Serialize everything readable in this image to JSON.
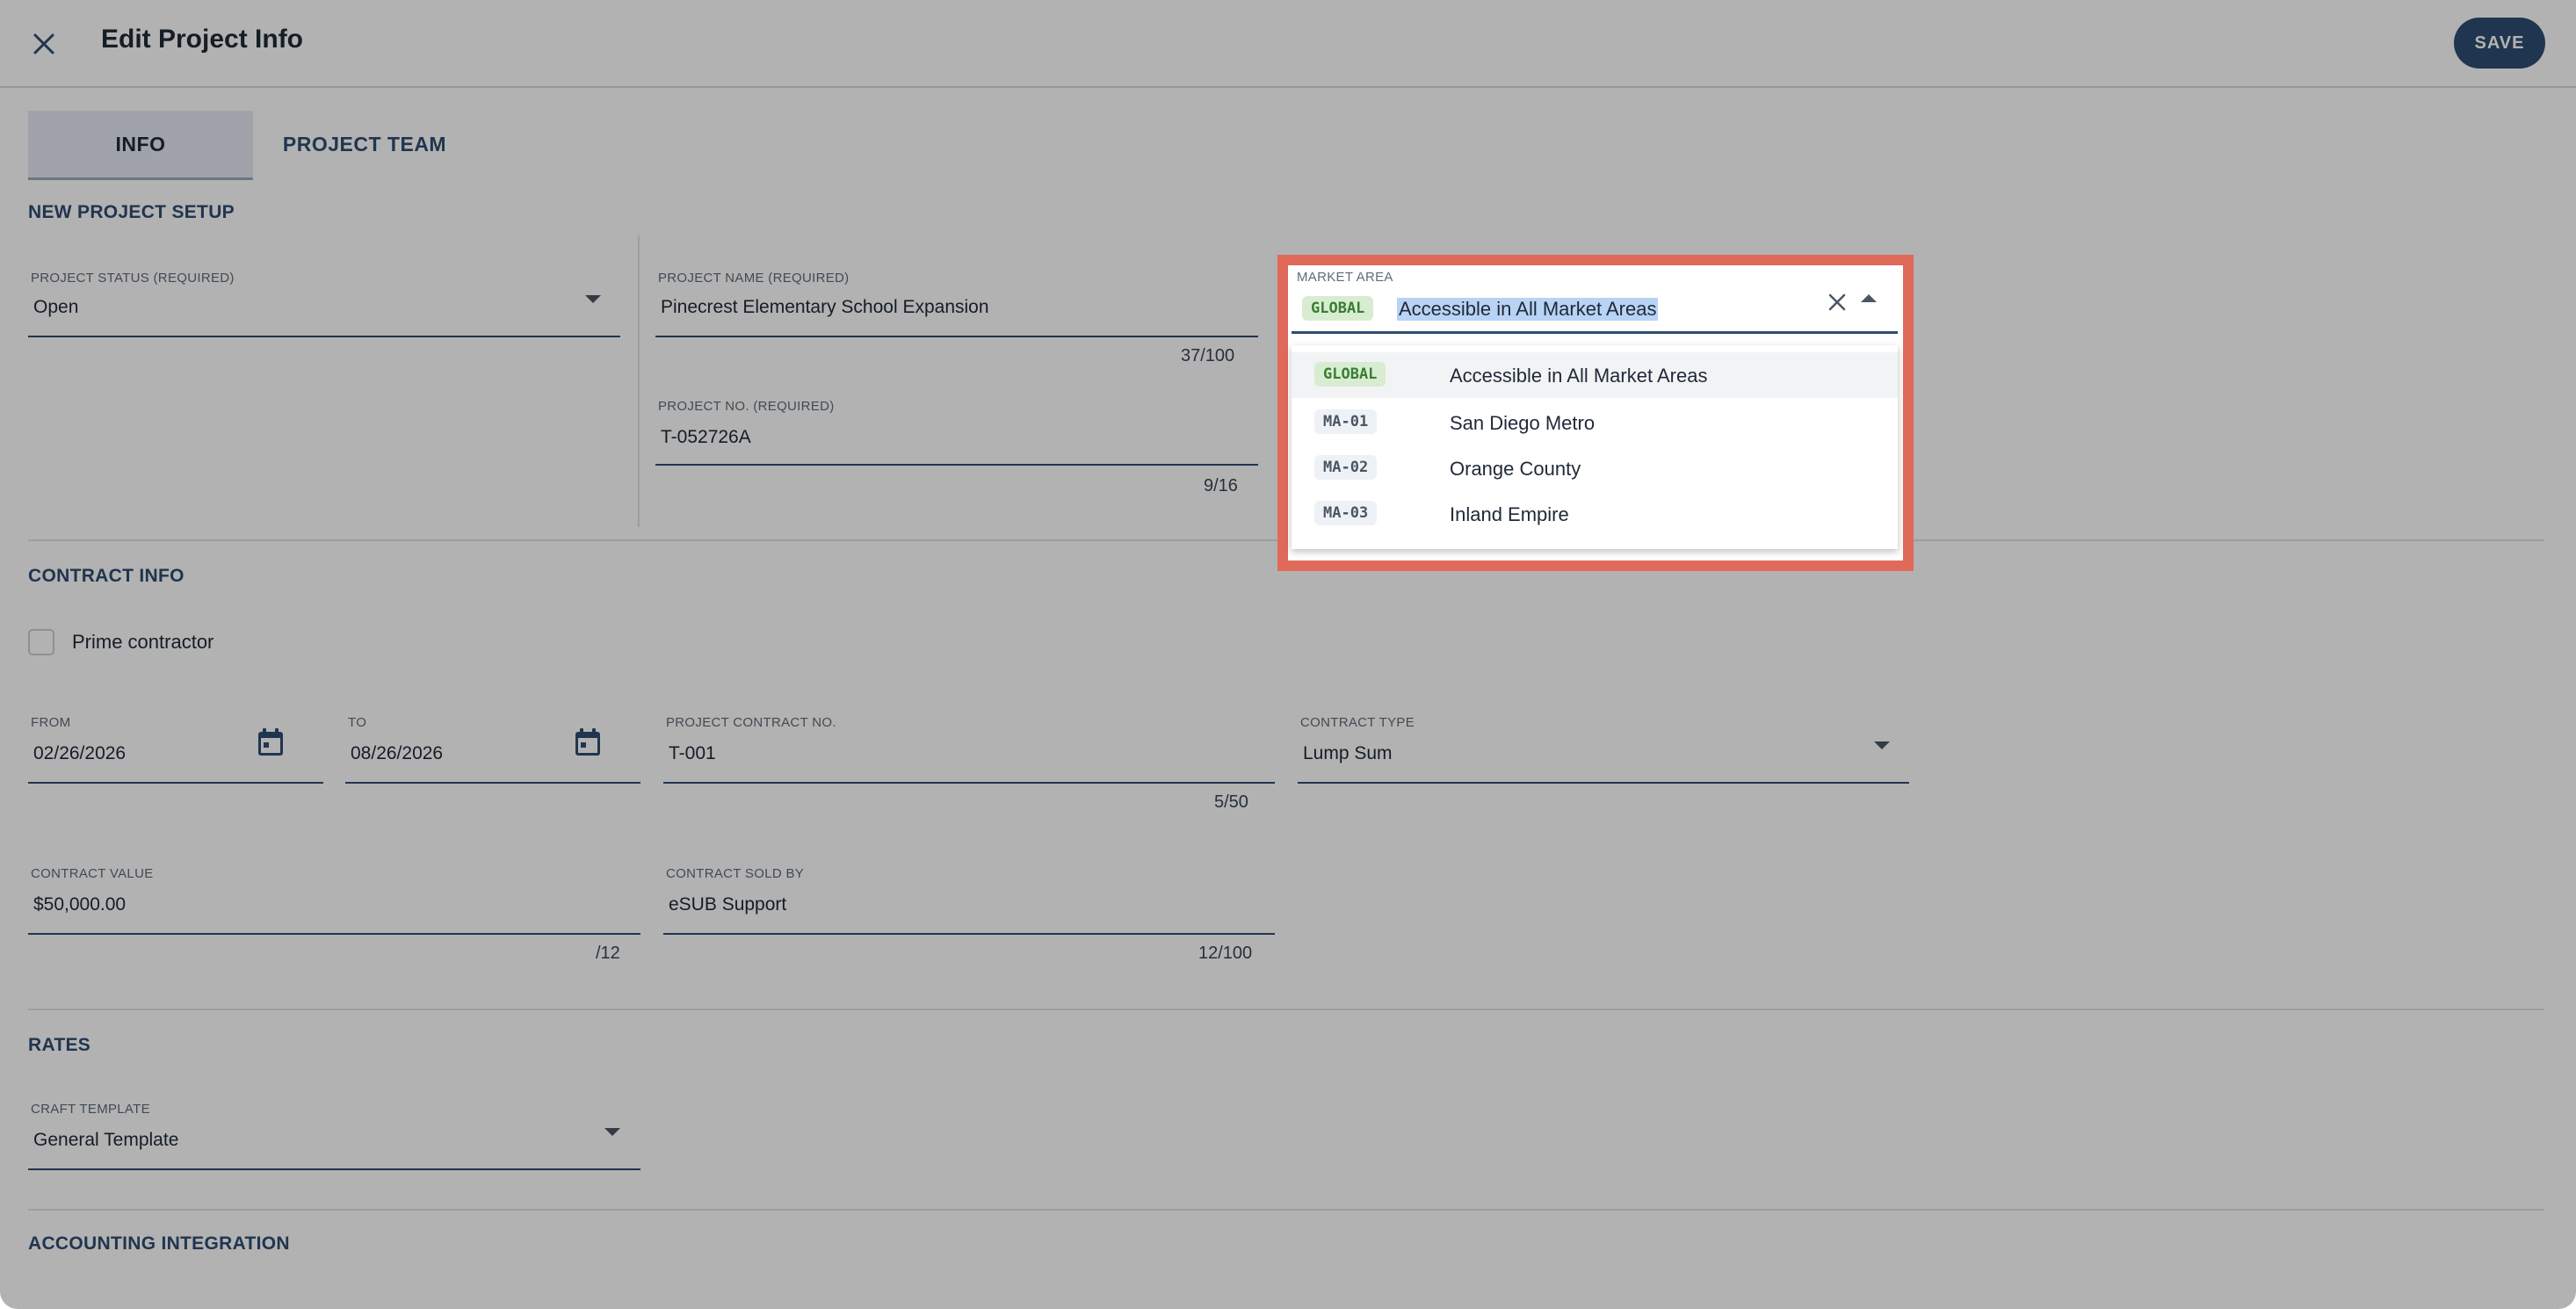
{
  "header": {
    "title": "Edit Project Info",
    "save_label": "SAVE"
  },
  "tabs": [
    {
      "label": "INFO",
      "active": true
    },
    {
      "label": "PROJECT TEAM",
      "active": false
    }
  ],
  "sections": {
    "new_project_setup": "NEW PROJECT SETUP",
    "contract_info": "CONTRACT INFO",
    "rates": "RATES",
    "accounting_integration": "ACCOUNTING INTEGRATION"
  },
  "project_status": {
    "label": "PROJECT STATUS (REQUIRED)",
    "value": "Open"
  },
  "project_name": {
    "label": "PROJECT NAME (REQUIRED)",
    "value": "Pinecrest Elementary School Expansion",
    "counter": "37/100"
  },
  "project_no": {
    "label": "PROJECT NO. (REQUIRED)",
    "value": "T-052726A",
    "counter": "9/16"
  },
  "market_area": {
    "label": "MARKET AREA",
    "selected_tag": "GLOBAL",
    "selected_value": "Accessible in All Market Areas",
    "options": [
      {
        "tag": "GLOBAL",
        "label": "Accessible in All Market Areas"
      },
      {
        "tag": "MA-01",
        "label": "San Diego Metro"
      },
      {
        "tag": "MA-02",
        "label": "Orange County"
      },
      {
        "tag": "MA-03",
        "label": "Inland Empire"
      }
    ]
  },
  "prime_contractor": {
    "label": "Prime contractor",
    "checked": false
  },
  "from_date": {
    "label": "FROM",
    "value": "02/26/2026"
  },
  "to_date": {
    "label": "TO",
    "value": "08/26/2026"
  },
  "project_contract_no": {
    "label": "PROJECT CONTRACT NO.",
    "value": "T-001",
    "counter": "5/50"
  },
  "contract_type": {
    "label": "CONTRACT TYPE",
    "value": "Lump Sum"
  },
  "contract_value": {
    "label": "CONTRACT VALUE",
    "value": "$50,000.00",
    "counter": "/12"
  },
  "contract_sold_by": {
    "label": "CONTRACT SOLD BY",
    "value": "eSUB Support",
    "counter": "12/100"
  },
  "craft_template": {
    "label": "CRAFT TEMPLATE",
    "value": "General Template"
  },
  "colors": {
    "primary": "#2f4d72",
    "highlight_border": "#e0695a",
    "global_tag_bg": "#d8ecd2"
  }
}
